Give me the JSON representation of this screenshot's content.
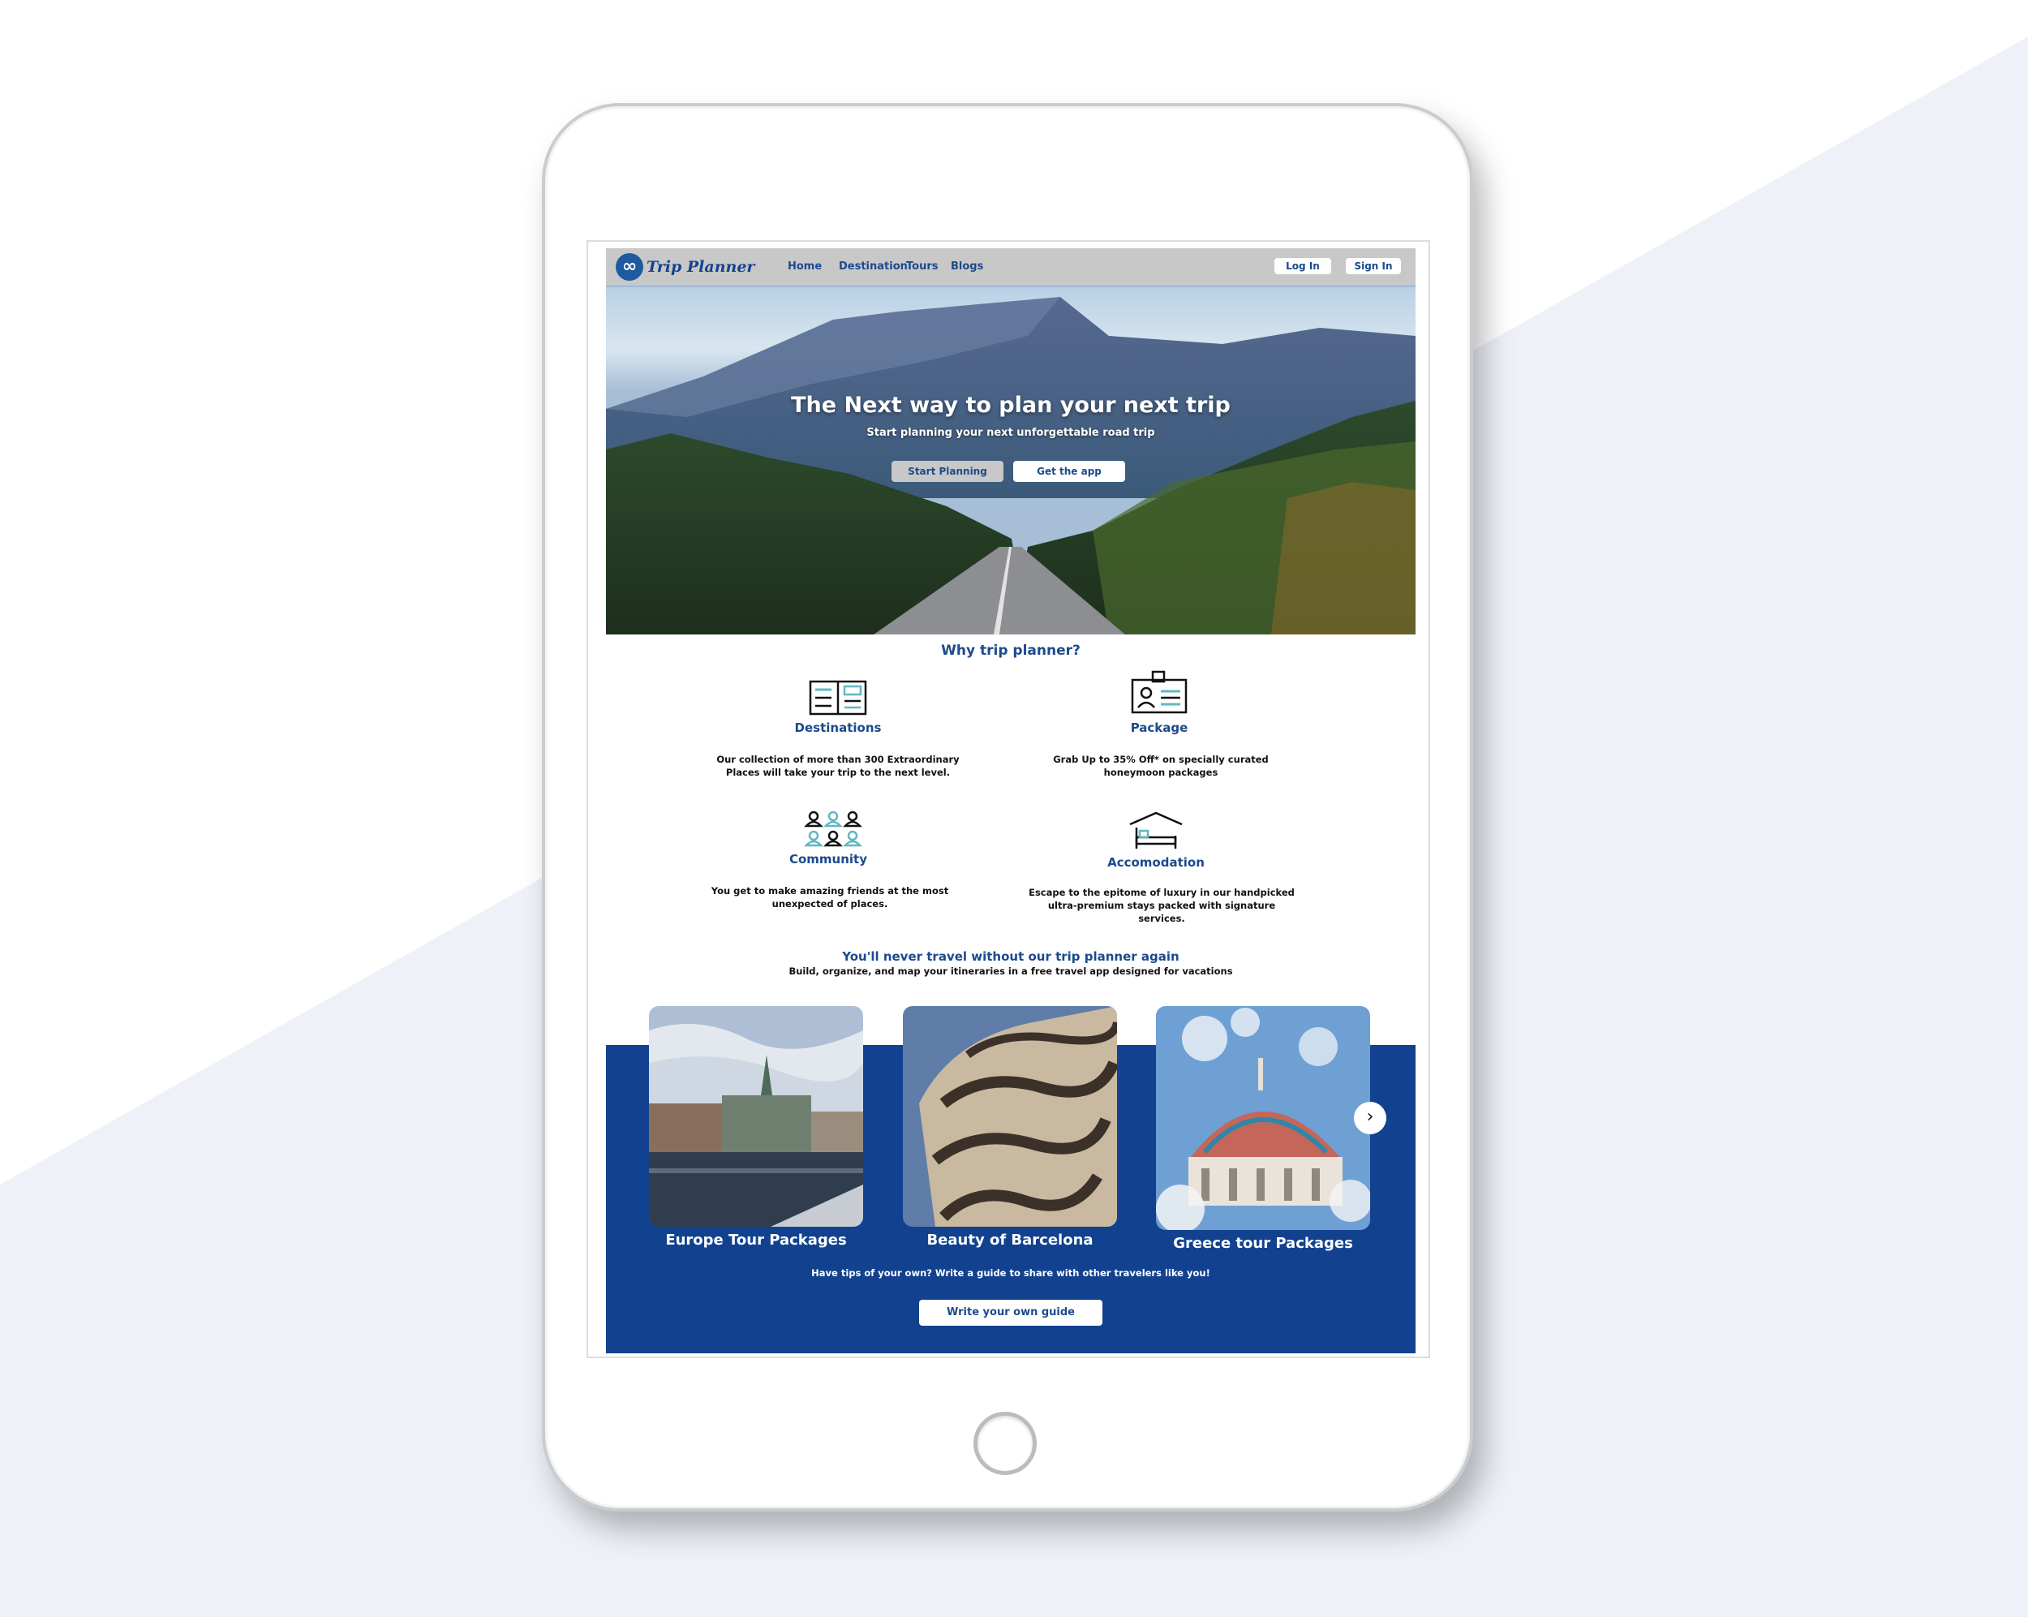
{
  "nav": {
    "logo_text": "Trip Planner",
    "links": [
      "Home",
      "Destination",
      "Tours",
      "Blogs"
    ],
    "login": "Log In",
    "signin": "Sign In"
  },
  "hero": {
    "title": "The Next way to plan your next trip",
    "subtitle": "Start planning your next unforgettable road trip",
    "primary_button": "Start Planning",
    "secondary_button": "Get the app"
  },
  "why": {
    "title": "Why trip planner?",
    "features": [
      {
        "icon": "book-icon",
        "title": "Destinations",
        "desc": "Our collection of more than 300 Extraordinary Places will take your trip to the next level."
      },
      {
        "icon": "id-card-icon",
        "title": "Package",
        "desc": "Grab Up to 35% Off* on specially curated honeymoon packages"
      },
      {
        "icon": "people-icon",
        "title": "Community",
        "desc": "You get to make amazing friends at the most unexpected of places."
      },
      {
        "icon": "bed-icon",
        "title": "Accomodation",
        "desc": "Escape to the epitome of luxury in our handpicked ultra-premium stays packed with signature services."
      }
    ]
  },
  "promo": {
    "title": "You'll never travel without our trip planner again",
    "subtitle": "Build, organize, and map your itineraries in a free travel app designed for vacations"
  },
  "cards": [
    {
      "label": "Europe Tour Packages"
    },
    {
      "label": "Beauty of  Barcelona"
    },
    {
      "label": "Greece tour Packages"
    }
  ],
  "guide": {
    "text": "Have tips of your own? Write a guide to share with other travelers like you!",
    "button": "Write your own guide"
  },
  "colors": {
    "brand": "#12428f",
    "nav": "#c8c8c8",
    "accent": "#5fb8c2"
  }
}
